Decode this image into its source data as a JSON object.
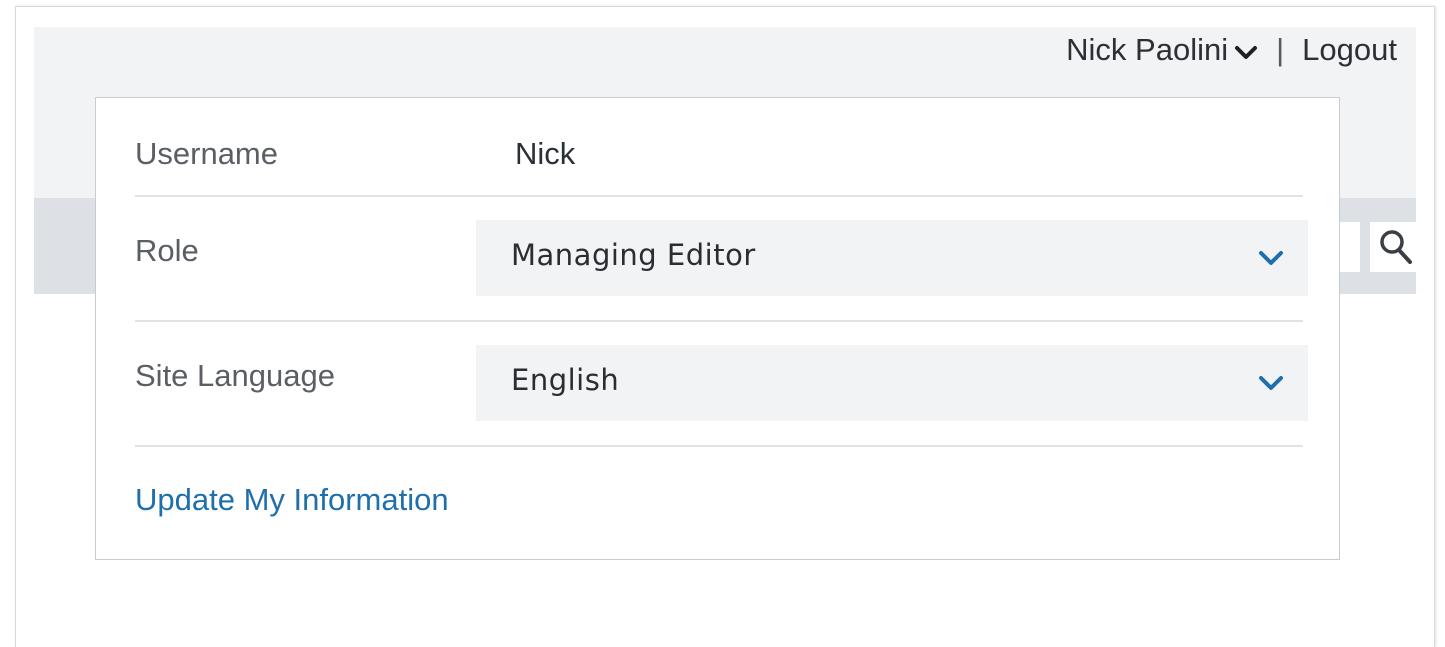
{
  "header": {
    "user_name": "Nick Paolini",
    "separator": "|",
    "logout_label": "Logout"
  },
  "profile_panel": {
    "username": {
      "label": "Username",
      "value": "Nick"
    },
    "role": {
      "label": "Role",
      "selected": "Managing Editor"
    },
    "site_language": {
      "label": "Site Language",
      "selected": "English"
    },
    "update_link": "Update My Information"
  },
  "icons": {
    "user_menu": "chevron-down-icon",
    "select": "chevron-down-icon",
    "search": "search-icon"
  },
  "colors": {
    "link": "#1f6fad",
    "caret": "#1f6fad",
    "header_bg": "#f2f3f4",
    "nav_bg": "#dde1e5",
    "select_bg": "#f2f3f5"
  }
}
